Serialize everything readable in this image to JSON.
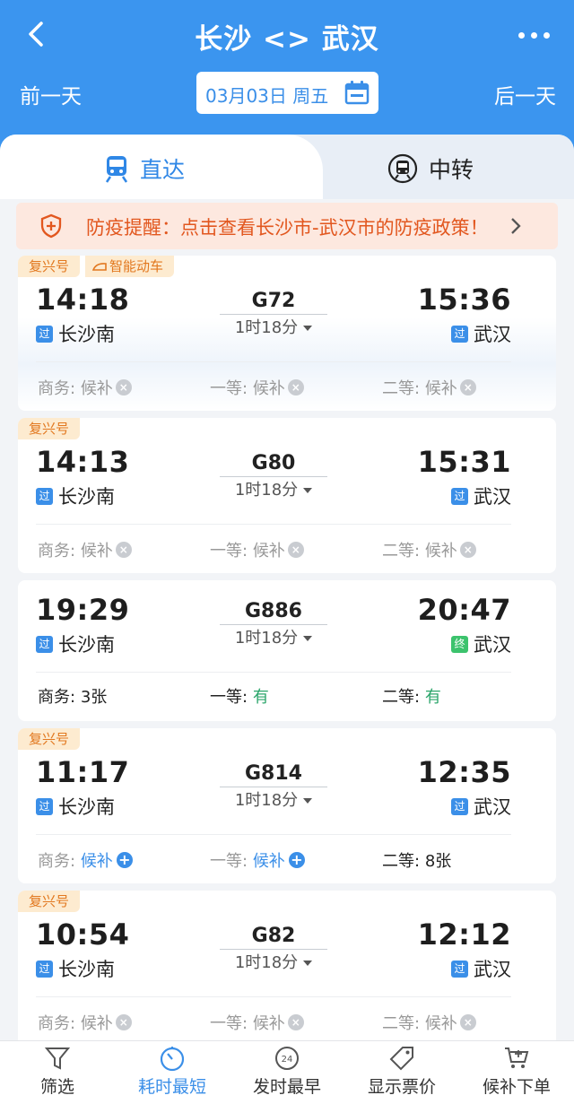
{
  "header": {
    "title": "长沙 <> 武汉",
    "prev_day": "前一天",
    "next_day": "后一天",
    "date": "03月03日 周五"
  },
  "tabs": {
    "direct": "直达",
    "transfer": "中转"
  },
  "notice": {
    "text": "防疫提醒：点击查看长沙市-武汉市的防疫政策！"
  },
  "trains": [
    {
      "tags": [
        "复兴号",
        "智能动车"
      ],
      "dep_time": "14:18",
      "arr_time": "15:36",
      "train_no": "G72",
      "duration": "1时18分",
      "dep_station": "长沙南",
      "arr_station": "武汉",
      "dep_badge": "过",
      "arr_badge": "过",
      "seats": [
        {
          "label": "商务:",
          "value": "候补"
        },
        {
          "label": "一等:",
          "value": "候补"
        },
        {
          "label": "二等:",
          "value": "候补"
        }
      ]
    },
    {
      "tags": [
        "复兴号"
      ],
      "dep_time": "14:13",
      "arr_time": "15:31",
      "train_no": "G80",
      "duration": "1时18分",
      "dep_station": "长沙南",
      "arr_station": "武汉",
      "dep_badge": "过",
      "arr_badge": "过",
      "seats": [
        {
          "label": "商务:",
          "value": "候补"
        },
        {
          "label": "一等:",
          "value": "候补"
        },
        {
          "label": "二等:",
          "value": "候补"
        }
      ]
    },
    {
      "tags": [],
      "dep_time": "19:29",
      "arr_time": "20:47",
      "train_no": "G886",
      "duration": "1时18分",
      "dep_station": "长沙南",
      "arr_station": "武汉",
      "dep_badge": "过",
      "arr_badge": "终",
      "seats": [
        {
          "label": "商务:",
          "value": "3张"
        },
        {
          "label": "一等:",
          "value": "有"
        },
        {
          "label": "二等:",
          "value": "有"
        }
      ]
    },
    {
      "tags": [
        "复兴号"
      ],
      "dep_time": "11:17",
      "arr_time": "12:35",
      "train_no": "G814",
      "duration": "1时18分",
      "dep_station": "长沙南",
      "arr_station": "武汉",
      "dep_badge": "过",
      "arr_badge": "过",
      "seats": [
        {
          "label": "商务:",
          "value": "候补"
        },
        {
          "label": "一等:",
          "value": "候补"
        },
        {
          "label": "二等:",
          "value": "8张"
        }
      ]
    },
    {
      "tags": [
        "复兴号"
      ],
      "dep_time": "10:54",
      "arr_time": "12:12",
      "train_no": "G82",
      "duration": "1时18分",
      "dep_station": "长沙南",
      "arr_station": "武汉",
      "dep_badge": "过",
      "arr_badge": "过",
      "seats": [
        {
          "label": "商务:",
          "value": "候补"
        },
        {
          "label": "一等:",
          "value": "候补"
        },
        {
          "label": "二等:",
          "value": "候补"
        }
      ]
    }
  ],
  "bottom_bar": {
    "filter": "筛选",
    "shortest": "耗时最短",
    "earliest": "发时最早",
    "show_price": "显示票价",
    "waitlist_order": "候补下单",
    "earliest_icon_text": "24"
  },
  "colors": {
    "header_bg": "#3b95ef",
    "accent_blue": "#3b8fe8",
    "notice_text": "#e2571f",
    "available_green": "#2aa56a"
  }
}
